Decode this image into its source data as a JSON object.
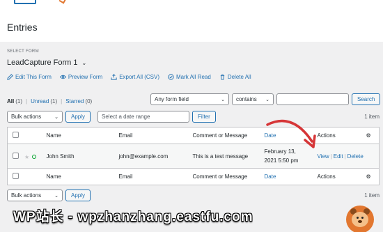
{
  "page": {
    "title": "Entries"
  },
  "form_select": {
    "label": "SELECT FORM",
    "value": "LeadCapture Form 1"
  },
  "actions": [
    {
      "label": "Edit This Form",
      "icon": "pencil-icon"
    },
    {
      "label": "Preview Form",
      "icon": "eye-icon"
    },
    {
      "label": "Export All (CSV)",
      "icon": "export-icon"
    },
    {
      "label": "Mark All Read",
      "icon": "circle-check-icon"
    },
    {
      "label": "Delete All",
      "icon": "trash-icon"
    }
  ],
  "filters": {
    "all": {
      "label": "All",
      "count": "(1)"
    },
    "unread": {
      "label": "Unread",
      "count": "(1)"
    },
    "starred": {
      "label": "Starred",
      "count": "(0)"
    }
  },
  "search": {
    "field_value": "Any form field",
    "operator_value": "contains",
    "query_value": "",
    "button": "Search"
  },
  "bulk": {
    "label": "Bulk actions",
    "apply": "Apply",
    "date_placeholder": "Select a date range",
    "filter": "Filter",
    "items_count": "1 item"
  },
  "table": {
    "columns": {
      "name": "Name",
      "email": "Email",
      "message": "Comment or Message",
      "date": "Date",
      "actions": "Actions"
    },
    "rows": [
      {
        "name": "John Smith",
        "email": "john@example.com",
        "message": "This is a test message",
        "date_line1": "February 13,",
        "date_line2": "2021 5:50 pm",
        "view": "View",
        "edit": "Edit",
        "delete": "Delete"
      }
    ]
  },
  "colors": {
    "accent": "#2271b1",
    "annotation": "#d63638",
    "brand": "#e27730"
  },
  "watermark": "WP站长 - wpzhanzhang.eastfu.com"
}
